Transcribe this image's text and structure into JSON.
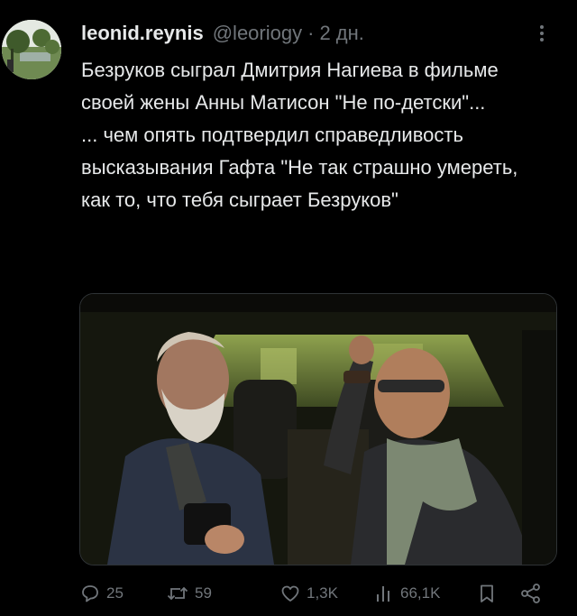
{
  "tweet": {
    "author": {
      "name": "leonid.reynis",
      "handle": "@leoriogy",
      "separator": "·",
      "time": "2 дн."
    },
    "text_paragraphs": [
      "Безруков сыграл Дмитрия Нагиева в фильме своей жены Анны Матисон \"Не по-детски\"...",
      "... чем опять подтвердил справедливость высказывания Гафта \"Не так страшно умереть, как то, что тебя сыграет Безруков\""
    ],
    "actions": {
      "replies": "25",
      "reposts": "59",
      "likes": "1,3K",
      "views": "66,1K"
    },
    "icons": {
      "more": "more-dots-icon",
      "reply": "reply-bubble-icon",
      "repost": "repost-arrows-icon",
      "like": "heart-icon",
      "views": "bar-chart-icon",
      "bookmark": "bookmark-icon",
      "share": "share-icon"
    },
    "colors": {
      "background": "#000000",
      "text": "#e7e9ea",
      "muted": "#71767b"
    }
  }
}
